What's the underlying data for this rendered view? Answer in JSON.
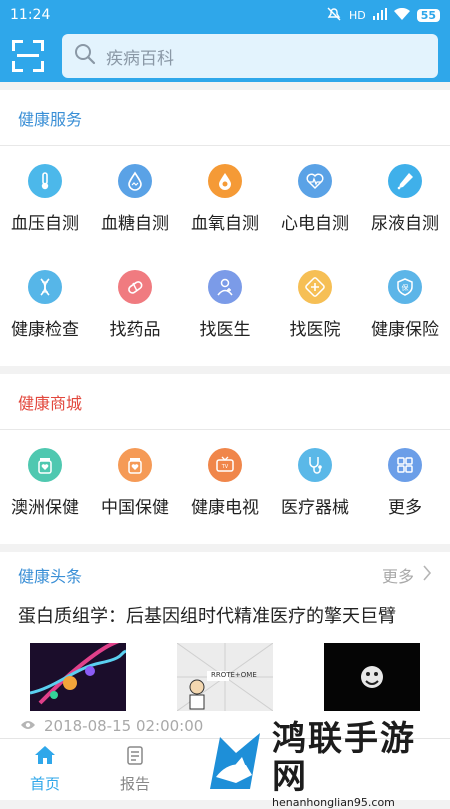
{
  "status": {
    "time": "11:24",
    "battery": "55",
    "network": "HD"
  },
  "search": {
    "placeholder": "疾病百科"
  },
  "sections": {
    "health_services": {
      "title": "健康服务",
      "title_color": "#3a8fd6",
      "items": [
        {
          "label": "血压自测",
          "icon": "thermometer-icon",
          "color": "#4cb8ea"
        },
        {
          "label": "血糖自测",
          "icon": "blood-drop-icon",
          "color": "#5aa2e6"
        },
        {
          "label": "血氧自测",
          "icon": "oxygen-drop-icon",
          "color": "#f59a36"
        },
        {
          "label": "心电自测",
          "icon": "heartbeat-icon",
          "color": "#5aa2e6"
        },
        {
          "label": "尿液自测",
          "icon": "dropper-icon",
          "color": "#3fb0ea"
        },
        {
          "label": "健康检查",
          "icon": "dna-icon",
          "color": "#56b6e8"
        },
        {
          "label": "找药品",
          "icon": "pill-icon",
          "color": "#f07b80"
        },
        {
          "label": "找医生",
          "icon": "doctor-icon",
          "color": "#7b9be8"
        },
        {
          "label": "找医院",
          "icon": "hospital-icon",
          "color": "#f6bf55"
        },
        {
          "label": "健康保险",
          "icon": "insurance-icon",
          "color": "#5cb5e8"
        }
      ]
    },
    "health_mall": {
      "title": "健康商城",
      "title_color": "#e2483d",
      "items": [
        {
          "label": "澳洲保健",
          "icon": "supplement-jar-icon",
          "color": "#4fc8b0"
        },
        {
          "label": "中国保健",
          "icon": "heart-jar-icon",
          "color": "#f59a56"
        },
        {
          "label": "健康电视",
          "icon": "tv-icon",
          "color": "#f0864a"
        },
        {
          "label": "医疗器械",
          "icon": "stethoscope-icon",
          "color": "#5ab8e8"
        },
        {
          "label": "更多",
          "icon": "grid-icon",
          "color": "#6b9ee8"
        }
      ]
    },
    "headlines": {
      "title": "健康头条",
      "title_color": "#3a8fd6",
      "more_label": "更多",
      "article": {
        "title": "蛋白质组学：后基因组时代精准医疗的擎天巨臂",
        "image_caption": "RROTE+OME",
        "date": "2018-08-15 02:00:00"
      }
    }
  },
  "tabbar": {
    "tabs": [
      {
        "label": "首页",
        "icon": "home-icon",
        "active": true
      },
      {
        "label": "报告",
        "icon": "report-icon",
        "active": false
      }
    ]
  },
  "watermark": {
    "title": "鸿联手游网",
    "url": "henanhonglian95.com"
  },
  "colors": {
    "accent": "#2fa7ea",
    "search_bg": "#e3f3fd"
  }
}
